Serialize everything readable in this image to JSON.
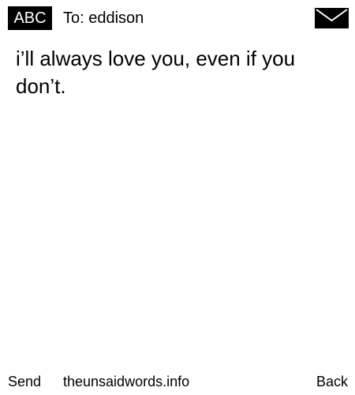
{
  "header": {
    "input_mode": "ABC",
    "to_label": "To: eddison",
    "mail_icon": "envelope-icon"
  },
  "message": {
    "text": "i’ll always love you, even if you don’t."
  },
  "footer": {
    "send_label": "Send",
    "site_label": "theunsaidwords.info",
    "back_label": "Back"
  },
  "colors": {
    "background": "#ffffff",
    "text": "#000000",
    "badge_background": "#000000",
    "badge_text": "#ffffff"
  }
}
